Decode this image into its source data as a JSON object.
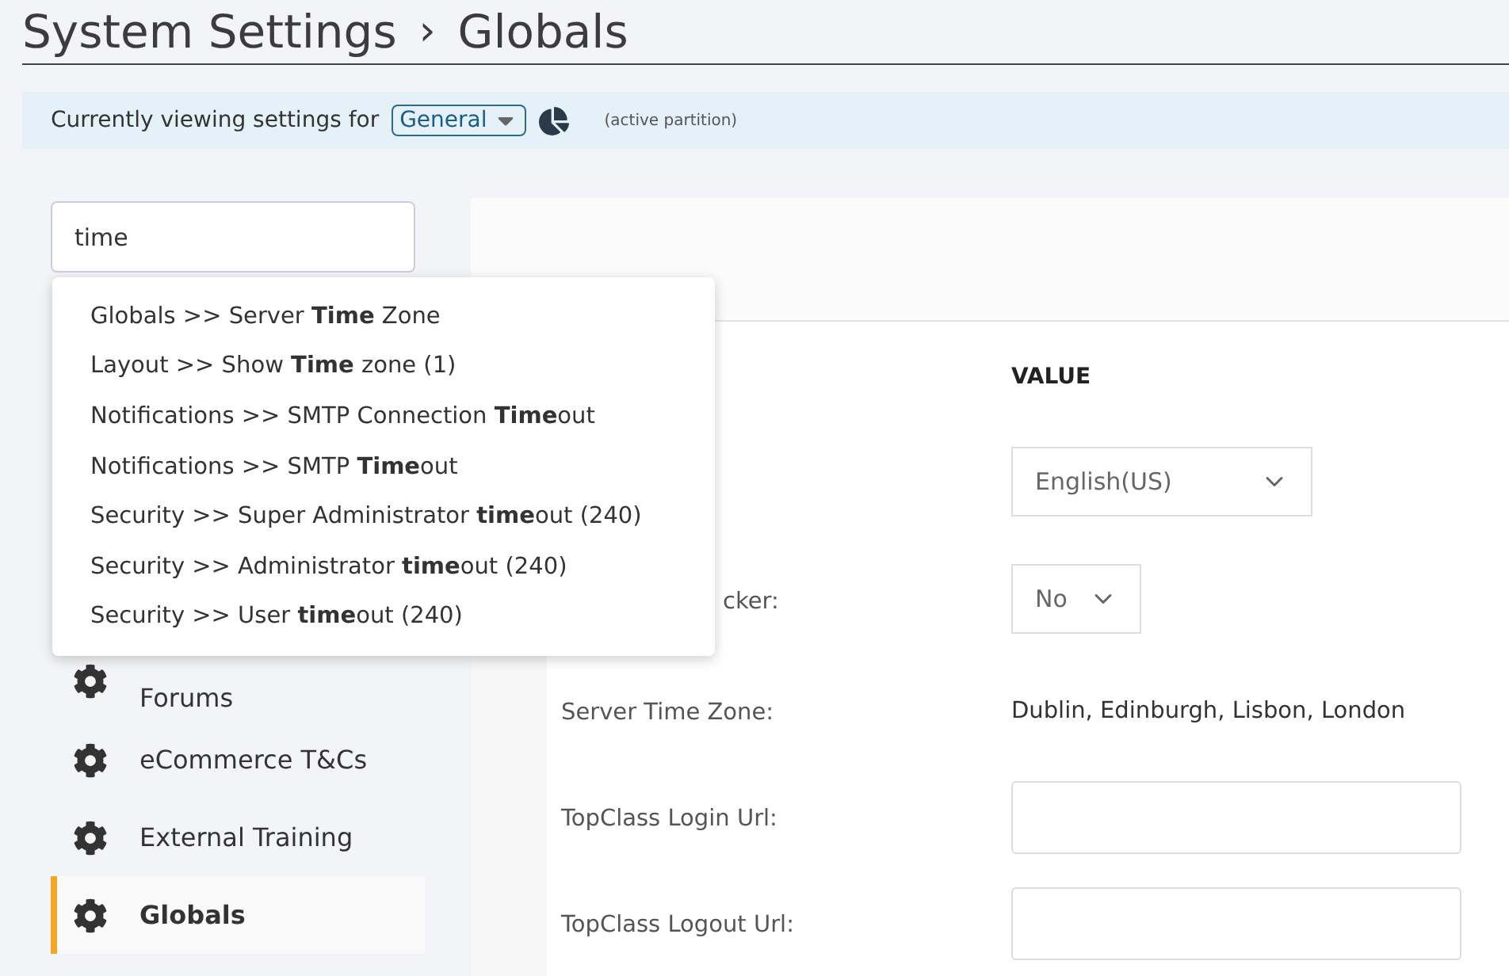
{
  "header": {
    "title": "System Settings",
    "separator": "›",
    "current": "Globals"
  },
  "partition_bar": {
    "label": "Currently viewing settings for",
    "partition": "General",
    "note": "(active partition)"
  },
  "search": {
    "value": "time"
  },
  "suggestions": [
    "Globals >> Server **Time** Zone",
    "Layout >> Show **Time** zone (1)",
    "Notifications >> SMTP Connection **Time**out",
    "Notifications >> SMTP **Time**out",
    "Security >> Super Administrator **time**out (240)",
    "Security >> Administrator **time**out (240)",
    "Security >> User **time**out (240)"
  ],
  "sidebar": {
    "items": [
      {
        "label": "Forums",
        "selected": false
      },
      {
        "label": "eCommerce T&Cs",
        "selected": false
      },
      {
        "label": "External Training",
        "selected": false
      },
      {
        "label": "Globals",
        "selected": true
      }
    ]
  },
  "settings": {
    "value_heading": "VALUE",
    "rows": [
      {
        "kind": "select",
        "value": "English(US)"
      },
      {
        "kind": "select",
        "label": "cker:",
        "value": "No"
      },
      {
        "kind": "text",
        "label": "Server Time Zone:",
        "value": "Dublin, Edinburgh, Lisbon, London"
      },
      {
        "kind": "input",
        "label": "TopClass Login Url:"
      },
      {
        "kind": "input",
        "label": "TopClass Logout Url:"
      }
    ]
  }
}
